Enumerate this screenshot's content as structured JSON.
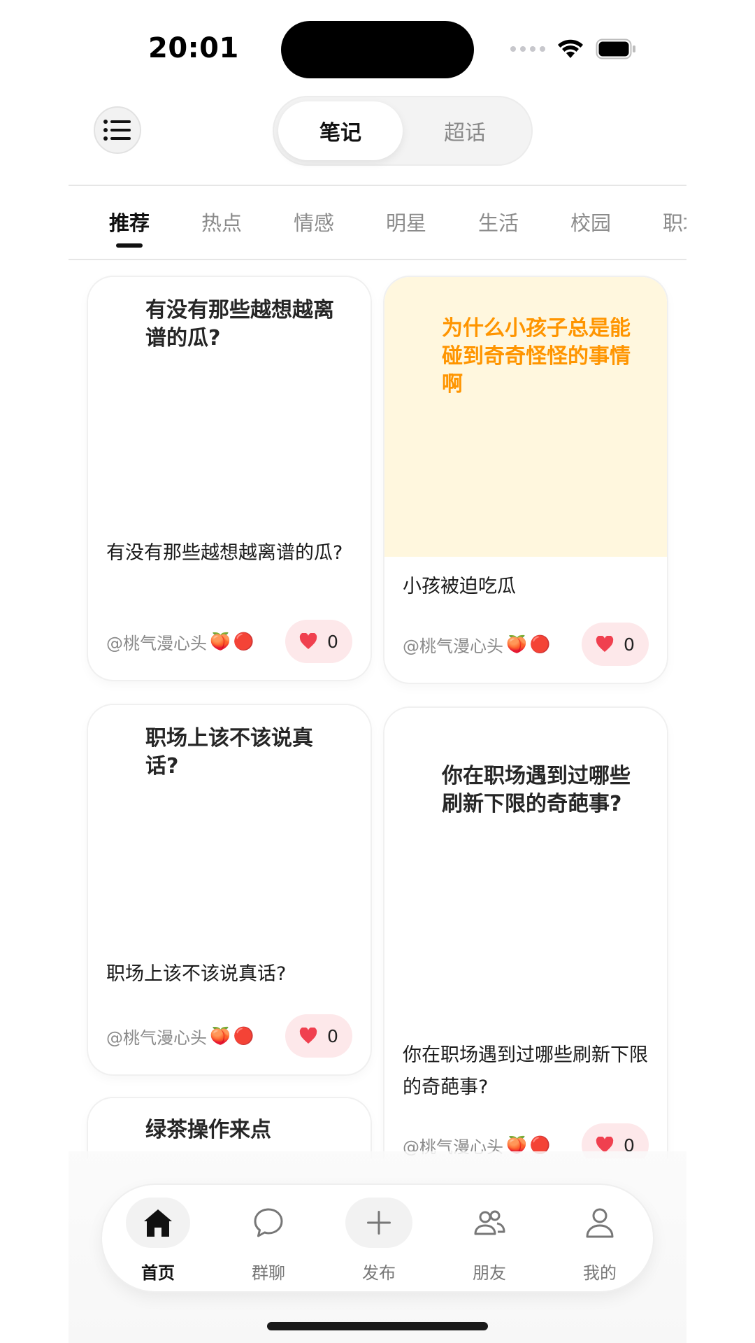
{
  "status_bar": {
    "time": "20:01"
  },
  "header": {
    "segments": [
      {
        "label": "笔记",
        "active": true
      },
      {
        "label": "超话",
        "active": false
      }
    ]
  },
  "categories": [
    {
      "label": "推荐",
      "active": true
    },
    {
      "label": "热点"
    },
    {
      "label": "情感"
    },
    {
      "label": "明星"
    },
    {
      "label": "生活"
    },
    {
      "label": "校园"
    },
    {
      "label": "职场"
    }
  ],
  "cards": [
    {
      "cover_text": "有没有那些越想越离谱的瓜?",
      "title": "有没有那些越想越离谱的瓜?",
      "author": "@桃气漫心头",
      "likes": "0",
      "cover_color": "#ffffff"
    },
    {
      "cover_text": "为什么小孩子总是能碰到奇奇怪怪的事情啊",
      "title": "小孩被迫吃瓜",
      "author": "@桃气漫心头",
      "likes": "0",
      "cover_color": "#fff7de",
      "cover_text_color": "#ff9500"
    },
    {
      "cover_text": "职场上该不该说真话?",
      "title": "职场上该不该说真话?",
      "author": "@桃气漫心头",
      "likes": "0",
      "cover_color": "#ffffff"
    },
    {
      "cover_text": "你在职场遇到过哪些刷新下限的奇葩事?",
      "title": "你在职场遇到过哪些刷新下限的奇葩事?",
      "author": "@桃气漫心头",
      "likes": "0",
      "cover_color": "#ffffff"
    },
    {
      "cover_text": "绿茶操作来点",
      "cover_color": "#ffffff"
    }
  ],
  "author_emojis": {
    "peach": "🍑",
    "dot": "🔴"
  },
  "tab_bar": {
    "items": [
      {
        "label": "首页",
        "icon": "home-icon",
        "active": true
      },
      {
        "label": "群聊",
        "icon": "chat-bubble-icon"
      },
      {
        "label": "发布",
        "icon": "plus-icon"
      },
      {
        "label": "朋友",
        "icon": "friends-icon"
      },
      {
        "label": "我的",
        "icon": "profile-icon"
      }
    ]
  },
  "colors": {
    "accent_text": "#111111",
    "like_pill_bg": "#fde8ea",
    "heart": "#f0404f",
    "highlight_orange": "#ff9500"
  }
}
